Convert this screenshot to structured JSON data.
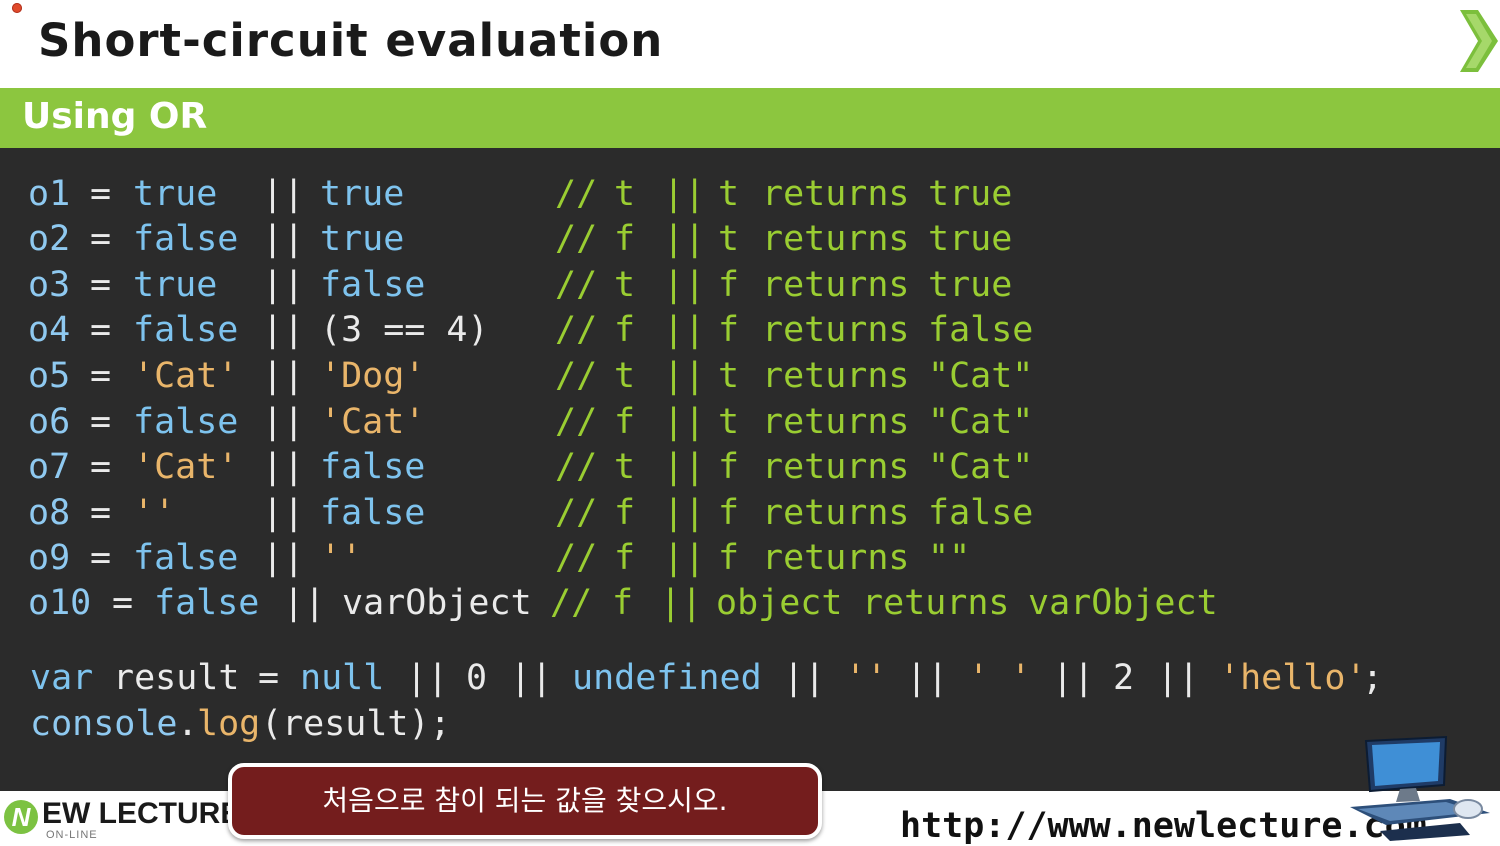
{
  "header": {
    "title": "Short-circuit evaluation",
    "next_icon": "chevron-right-icon",
    "colors": {
      "accent_green": "#8cc63f",
      "code_bg": "#2b2b2b"
    }
  },
  "section": {
    "label": "Using OR"
  },
  "code": {
    "lines": [
      {
        "var": "o1",
        "eq": "=",
        "a": "true",
        "op": "||",
        "b": "true",
        "cm": "//",
        "ca": "t",
        "cop": "||",
        "cb": "t",
        "ret": "returns",
        "res": "true"
      },
      {
        "var": "o2",
        "eq": "=",
        "a": "false",
        "op": "||",
        "b": "true",
        "cm": "//",
        "ca": "f",
        "cop": "||",
        "cb": "t",
        "ret": "returns",
        "res": "true"
      },
      {
        "var": "o3",
        "eq": "=",
        "a": "true",
        "op": "||",
        "b": "false",
        "cm": "//",
        "ca": "t",
        "cop": "||",
        "cb": "f",
        "ret": "returns",
        "res": "true"
      },
      {
        "var": "o4",
        "eq": "=",
        "a": "false",
        "op": "||",
        "b": "(3 == 4)",
        "cm": "//",
        "ca": "f",
        "cop": "||",
        "cb": "f",
        "ret": "returns",
        "res": "false"
      },
      {
        "var": "o5",
        "eq": "=",
        "a": "'Cat'",
        "op": "||",
        "b": "'Dog'",
        "cm": "//",
        "ca": "t",
        "cop": "||",
        "cb": "t",
        "ret": "returns",
        "res": "\"Cat\""
      },
      {
        "var": "o6",
        "eq": "=",
        "a": "false",
        "op": "||",
        "b": "'Cat'",
        "cm": "//",
        "ca": "f",
        "cop": "||",
        "cb": "t",
        "ret": "returns",
        "res": "\"Cat\""
      },
      {
        "var": "o7",
        "eq": "=",
        "a": "'Cat'",
        "op": "||",
        "b": "false",
        "cm": "//",
        "ca": "t",
        "cop": "||",
        "cb": "f",
        "ret": "returns",
        "res": "\"Cat\""
      },
      {
        "var": "o8",
        "eq": "=",
        "a": "''",
        "op": "||",
        "b": "false",
        "cm": "//",
        "ca": "f",
        "cop": "||",
        "cb": "f",
        "ret": "returns",
        "res": "false"
      },
      {
        "var": "o9",
        "eq": "=",
        "a": "false",
        "op": "||",
        "b": "''",
        "cm": "//",
        "ca": "f",
        "cop": "||",
        "cb": "f",
        "ret": "returns",
        "res": "\"\""
      },
      {
        "var": "o10",
        "eq": "=",
        "a": "false",
        "op": "||",
        "b": "varObject",
        "cm": "//",
        "ca": "f",
        "cop": "||",
        "cb": "object",
        "ret": "returns",
        "res": "varObject"
      }
    ],
    "result_line": {
      "kw": "var",
      "name": "result",
      "eq": "=",
      "t1": "null",
      "o1": "||",
      "t2": "0",
      "o2": "||",
      "t3": "undefined",
      "o3": "||",
      "t4": "''",
      "o4": "||",
      "t5": "' '",
      "o5": "||",
      "t6": "2",
      "o6": "||",
      "t7": "'hello'",
      "semi": ";"
    },
    "console_line": {
      "obj": "console",
      "dot": ".",
      "fn": "log",
      "args": "(result);"
    }
  },
  "footer": {
    "logo_mark": "N",
    "logo_text": "EW LECTURE",
    "logo_sub": "ON-LINE",
    "url": "http://www.newlecture.com",
    "computer_icon": "computer-icon"
  },
  "caption": {
    "text": "처음으로 참이 되는 값을 찾으시오."
  }
}
